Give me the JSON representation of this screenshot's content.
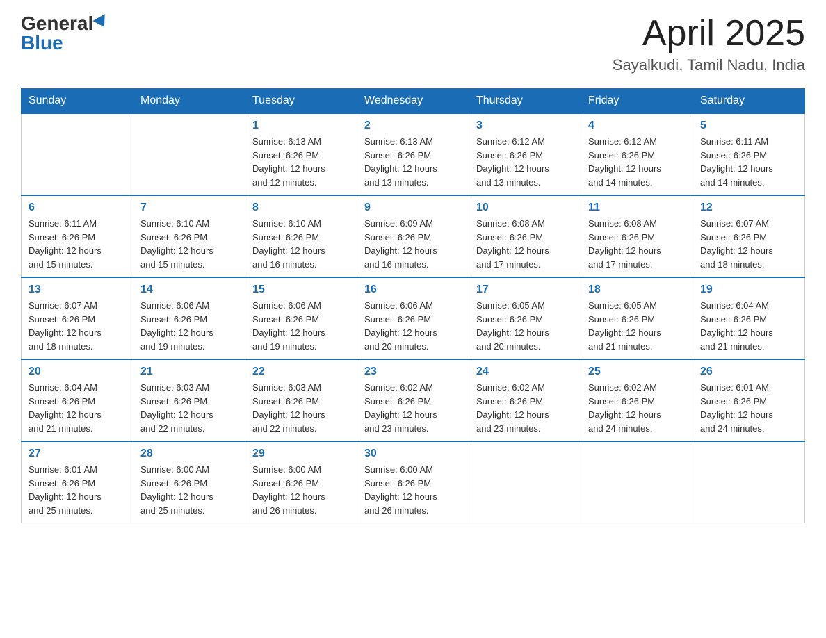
{
  "header": {
    "logo_general": "General",
    "logo_blue": "Blue",
    "title": "April 2025",
    "location": "Sayalkudi, Tamil Nadu, India"
  },
  "calendar": {
    "days_of_week": [
      "Sunday",
      "Monday",
      "Tuesday",
      "Wednesday",
      "Thursday",
      "Friday",
      "Saturday"
    ],
    "weeks": [
      [
        {
          "day": "",
          "info": ""
        },
        {
          "day": "",
          "info": ""
        },
        {
          "day": "1",
          "info": "Sunrise: 6:13 AM\nSunset: 6:26 PM\nDaylight: 12 hours\nand 12 minutes."
        },
        {
          "day": "2",
          "info": "Sunrise: 6:13 AM\nSunset: 6:26 PM\nDaylight: 12 hours\nand 13 minutes."
        },
        {
          "day": "3",
          "info": "Sunrise: 6:12 AM\nSunset: 6:26 PM\nDaylight: 12 hours\nand 13 minutes."
        },
        {
          "day": "4",
          "info": "Sunrise: 6:12 AM\nSunset: 6:26 PM\nDaylight: 12 hours\nand 14 minutes."
        },
        {
          "day": "5",
          "info": "Sunrise: 6:11 AM\nSunset: 6:26 PM\nDaylight: 12 hours\nand 14 minutes."
        }
      ],
      [
        {
          "day": "6",
          "info": "Sunrise: 6:11 AM\nSunset: 6:26 PM\nDaylight: 12 hours\nand 15 minutes."
        },
        {
          "day": "7",
          "info": "Sunrise: 6:10 AM\nSunset: 6:26 PM\nDaylight: 12 hours\nand 15 minutes."
        },
        {
          "day": "8",
          "info": "Sunrise: 6:10 AM\nSunset: 6:26 PM\nDaylight: 12 hours\nand 16 minutes."
        },
        {
          "day": "9",
          "info": "Sunrise: 6:09 AM\nSunset: 6:26 PM\nDaylight: 12 hours\nand 16 minutes."
        },
        {
          "day": "10",
          "info": "Sunrise: 6:08 AM\nSunset: 6:26 PM\nDaylight: 12 hours\nand 17 minutes."
        },
        {
          "day": "11",
          "info": "Sunrise: 6:08 AM\nSunset: 6:26 PM\nDaylight: 12 hours\nand 17 minutes."
        },
        {
          "day": "12",
          "info": "Sunrise: 6:07 AM\nSunset: 6:26 PM\nDaylight: 12 hours\nand 18 minutes."
        }
      ],
      [
        {
          "day": "13",
          "info": "Sunrise: 6:07 AM\nSunset: 6:26 PM\nDaylight: 12 hours\nand 18 minutes."
        },
        {
          "day": "14",
          "info": "Sunrise: 6:06 AM\nSunset: 6:26 PM\nDaylight: 12 hours\nand 19 minutes."
        },
        {
          "day": "15",
          "info": "Sunrise: 6:06 AM\nSunset: 6:26 PM\nDaylight: 12 hours\nand 19 minutes."
        },
        {
          "day": "16",
          "info": "Sunrise: 6:06 AM\nSunset: 6:26 PM\nDaylight: 12 hours\nand 20 minutes."
        },
        {
          "day": "17",
          "info": "Sunrise: 6:05 AM\nSunset: 6:26 PM\nDaylight: 12 hours\nand 20 minutes."
        },
        {
          "day": "18",
          "info": "Sunrise: 6:05 AM\nSunset: 6:26 PM\nDaylight: 12 hours\nand 21 minutes."
        },
        {
          "day": "19",
          "info": "Sunrise: 6:04 AM\nSunset: 6:26 PM\nDaylight: 12 hours\nand 21 minutes."
        }
      ],
      [
        {
          "day": "20",
          "info": "Sunrise: 6:04 AM\nSunset: 6:26 PM\nDaylight: 12 hours\nand 21 minutes."
        },
        {
          "day": "21",
          "info": "Sunrise: 6:03 AM\nSunset: 6:26 PM\nDaylight: 12 hours\nand 22 minutes."
        },
        {
          "day": "22",
          "info": "Sunrise: 6:03 AM\nSunset: 6:26 PM\nDaylight: 12 hours\nand 22 minutes."
        },
        {
          "day": "23",
          "info": "Sunrise: 6:02 AM\nSunset: 6:26 PM\nDaylight: 12 hours\nand 23 minutes."
        },
        {
          "day": "24",
          "info": "Sunrise: 6:02 AM\nSunset: 6:26 PM\nDaylight: 12 hours\nand 23 minutes."
        },
        {
          "day": "25",
          "info": "Sunrise: 6:02 AM\nSunset: 6:26 PM\nDaylight: 12 hours\nand 24 minutes."
        },
        {
          "day": "26",
          "info": "Sunrise: 6:01 AM\nSunset: 6:26 PM\nDaylight: 12 hours\nand 24 minutes."
        }
      ],
      [
        {
          "day": "27",
          "info": "Sunrise: 6:01 AM\nSunset: 6:26 PM\nDaylight: 12 hours\nand 25 minutes."
        },
        {
          "day": "28",
          "info": "Sunrise: 6:00 AM\nSunset: 6:26 PM\nDaylight: 12 hours\nand 25 minutes."
        },
        {
          "day": "29",
          "info": "Sunrise: 6:00 AM\nSunset: 6:26 PM\nDaylight: 12 hours\nand 26 minutes."
        },
        {
          "day": "30",
          "info": "Sunrise: 6:00 AM\nSunset: 6:26 PM\nDaylight: 12 hours\nand 26 minutes."
        },
        {
          "day": "",
          "info": ""
        },
        {
          "day": "",
          "info": ""
        },
        {
          "day": "",
          "info": ""
        }
      ]
    ]
  }
}
